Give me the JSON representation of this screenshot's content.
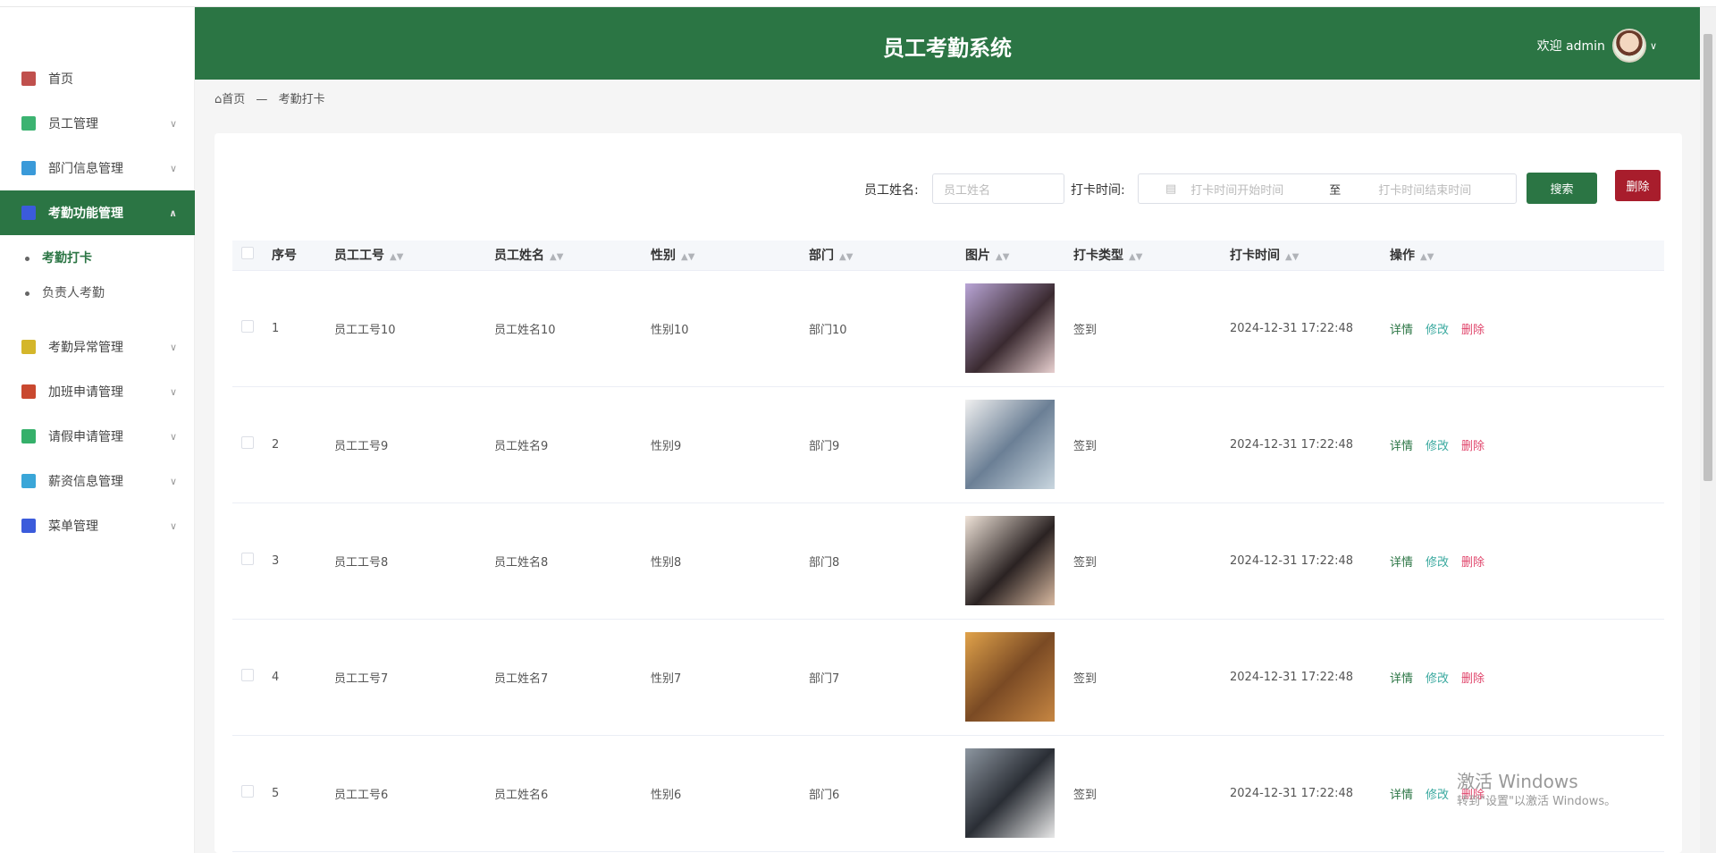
{
  "header": {
    "title": "员工考勤系统",
    "welcome": "欢迎 admin"
  },
  "breadcrumb": {
    "home": "首页",
    "separator": "—",
    "current": "考勤打卡"
  },
  "sidebar": {
    "items": [
      {
        "label": "首页",
        "icon": "home-icon",
        "color": "#c0504d"
      },
      {
        "label": "员工管理",
        "icon": "user-icon",
        "color": "#3cb371"
      },
      {
        "label": "部门信息管理",
        "icon": "building-icon",
        "color": "#3a9ad9"
      },
      {
        "label": "考勤功能管理",
        "icon": "book-icon",
        "color": "#3b5bdb",
        "active": true
      },
      {
        "label": "考勤异常管理",
        "icon": "folder-icon",
        "color": "#d4b62a"
      },
      {
        "label": "加班申请管理",
        "icon": "copy-icon",
        "color": "#c9482f"
      },
      {
        "label": "请假申请管理",
        "icon": "bookmark-icon",
        "color": "#35b06a"
      },
      {
        "label": "薪资信息管理",
        "icon": "card-icon",
        "color": "#3aa6d8"
      },
      {
        "label": "菜单管理",
        "icon": "grid-icon",
        "color": "#3b5bdb"
      }
    ],
    "sub_items": [
      {
        "label": "考勤打卡",
        "active": true
      },
      {
        "label": "负责人考勤"
      }
    ]
  },
  "search": {
    "name_label": "员工姓名:",
    "name_placeholder": "员工姓名",
    "time_label": "打卡时间:",
    "start_placeholder": "打卡时间开始时间",
    "to": "至",
    "end_placeholder": "打卡时间结束时间",
    "search_button": "搜索",
    "delete_button": "删除"
  },
  "table": {
    "columns": [
      "序号",
      "员工工号",
      "员工姓名",
      "性别",
      "部门",
      "图片",
      "打卡类型",
      "打卡时间",
      "操作"
    ],
    "rows": [
      {
        "no": "1",
        "emp_id": "员工工号10",
        "name": "员工姓名10",
        "gender": "性别10",
        "dept": "部门10",
        "type": "签到",
        "time": "2024-12-31 17:22:48"
      },
      {
        "no": "2",
        "emp_id": "员工工号9",
        "name": "员工姓名9",
        "gender": "性别9",
        "dept": "部门9",
        "type": "签到",
        "time": "2024-12-31 17:22:48"
      },
      {
        "no": "3",
        "emp_id": "员工工号8",
        "name": "员工姓名8",
        "gender": "性别8",
        "dept": "部门8",
        "type": "签到",
        "time": "2024-12-31 17:22:48"
      },
      {
        "no": "4",
        "emp_id": "员工工号7",
        "name": "员工姓名7",
        "gender": "性别7",
        "dept": "部门7",
        "type": "签到",
        "time": "2024-12-31 17:22:48"
      },
      {
        "no": "5",
        "emp_id": "员工工号6",
        "name": "员工姓名6",
        "gender": "性别6",
        "dept": "部门6",
        "type": "签到",
        "time": "2024-12-31 17:22:48"
      }
    ],
    "actions": {
      "detail": "详情",
      "edit": "修改",
      "delete": "删除"
    }
  },
  "colors": {
    "primary": "#2b7544",
    "danger": "#a81d2c",
    "edit": "#3aa99f",
    "delete_link": "#e0456b"
  },
  "watermark": {
    "line1": "激活 Windows",
    "line2": "转到\"设置\"以激活 Windows。"
  }
}
